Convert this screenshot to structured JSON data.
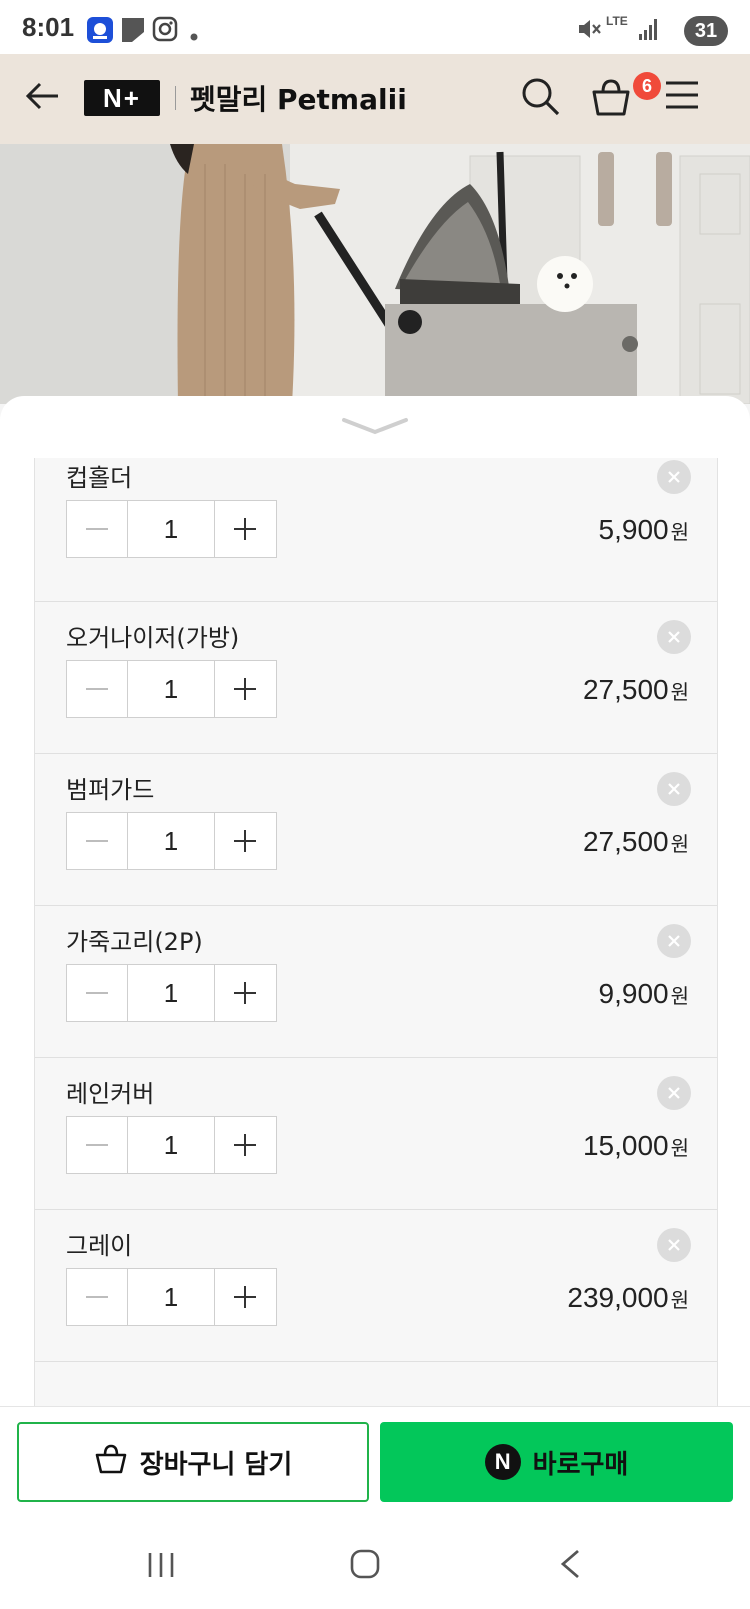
{
  "status_bar": {
    "time": "8:01",
    "notif_icons": [
      "joonggonara-app-icon",
      "square-icon",
      "instagram-icon",
      "dot-icon"
    ],
    "network_label": "LTE",
    "battery_level": "31"
  },
  "header": {
    "back_icon": "arrow-left-icon",
    "logo_text": "N+",
    "store_name": "펫말리 Petmalii",
    "cart_count": "6"
  },
  "items": [
    {
      "name": "컵홀더",
      "qty": "1",
      "price": "5,900",
      "currency": "원"
    },
    {
      "name": "오거나이저(가방)",
      "qty": "1",
      "price": "27,500",
      "currency": "원"
    },
    {
      "name": "범퍼가드",
      "qty": "1",
      "price": "27,500",
      "currency": "원"
    },
    {
      "name": "가죽고리(2P)",
      "qty": "1",
      "price": "9,900",
      "currency": "원"
    },
    {
      "name": "레인커버",
      "qty": "1",
      "price": "15,000",
      "currency": "원"
    },
    {
      "name": "그레이",
      "qty": "1",
      "price": "239,000",
      "currency": "원"
    }
  ],
  "actions": {
    "add_to_cart": "장바구니 담기",
    "buy_now": "바로구매",
    "buy_badge": "N"
  },
  "colors": {
    "header_bg": "#ece4db",
    "buy_green": "#03c75a",
    "badge_red": "#f04a3a"
  }
}
